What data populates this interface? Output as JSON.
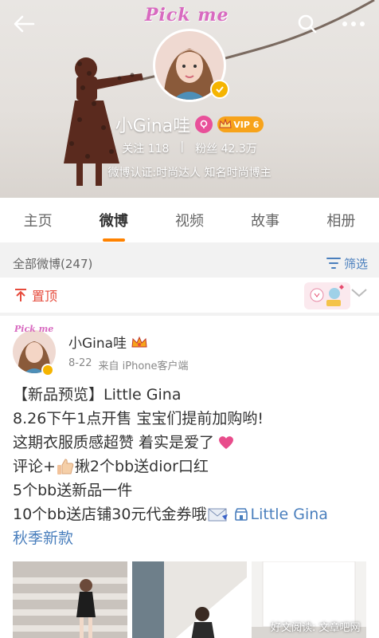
{
  "header": {
    "pick_me": "Pick me",
    "profile_name": "小Gina哇",
    "vip_label": "VIP 6",
    "following_label": "关注",
    "following_count": "118",
    "divider": "|",
    "followers_label": "粉丝",
    "followers_count": "42.3万",
    "certification": "微博认证:时尚达人 知名时尚博主"
  },
  "tabs": [
    {
      "label": "主页",
      "active": false
    },
    {
      "label": "微博",
      "active": true
    },
    {
      "label": "视频",
      "active": false
    },
    {
      "label": "故事",
      "active": false
    },
    {
      "label": "相册",
      "active": false
    }
  ],
  "filter": {
    "count_label": "全部微博(247)",
    "filter_label": "筛选"
  },
  "pinned": {
    "label": "置顶"
  },
  "post": {
    "mini_pick": "Pick me",
    "author": "小Gina哇",
    "date": "8-22",
    "source": "来自 iPhone客户端",
    "lines": {
      "l1": "【新品预览】Little Gina",
      "l2": "8.26下午1点开售 宝宝们提前加购哟!",
      "l3": "这期衣服质感超赞 着实是爱了",
      "l4a": "评论+",
      "l4b": " 揪2个bb送dior口红",
      "l5": "5个bb送新品一件",
      "l6": "10个bb送店铺30元代金券哦",
      "link1": "Little Gina",
      "link2": "秋季新款"
    }
  },
  "watermark": "好文阅读: 文章吧网",
  "colors": {
    "accent_orange": "#ff8200",
    "link_blue": "#4a7fbd",
    "pin_red": "#e64b3c",
    "vip_gold": "#f7a31b",
    "verified_gold": "#f5b400",
    "pink": "#e8509a"
  }
}
